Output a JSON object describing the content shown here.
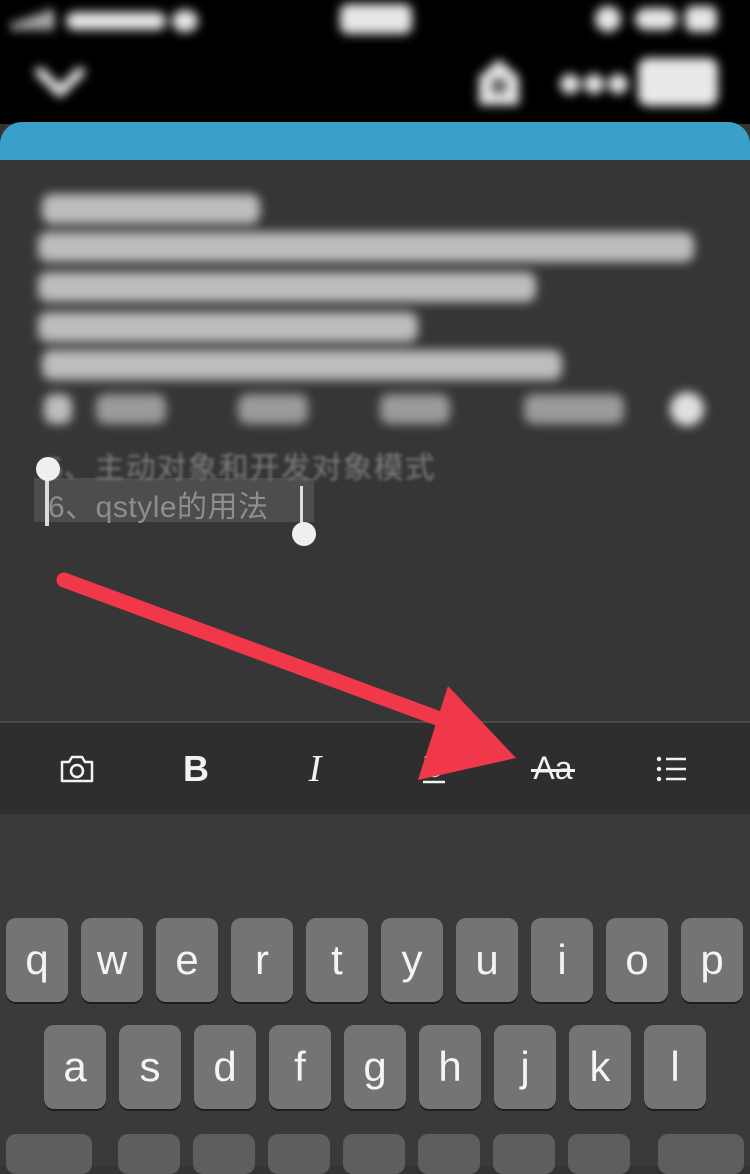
{
  "status_bar": {
    "signal_icon": "cellular-signal-icon",
    "carrier_text": "",
    "time": "",
    "battery_icon": "battery-icon"
  },
  "nav": {
    "back_icon": "chevron-down-icon",
    "home_icon": "home-icon",
    "more_icon": "more-dots-icon",
    "done_label": ""
  },
  "note": {
    "visible_line_5": "5、主动对象和开发对象模式",
    "selected_line_6": "6、qstyle的用法"
  },
  "toolbar": {
    "items": [
      {
        "name": "camera",
        "icon": "camera-icon",
        "label": ""
      },
      {
        "name": "bold",
        "icon": "bold-icon",
        "label": "B"
      },
      {
        "name": "italic",
        "icon": "italic-icon",
        "label": "I"
      },
      {
        "name": "underline",
        "icon": "underline-icon",
        "label": ""
      },
      {
        "name": "strikethrough",
        "icon": "strikethrough-icon",
        "label": "Aa"
      },
      {
        "name": "list",
        "icon": "list-icon",
        "label": ""
      }
    ]
  },
  "annotation": {
    "icon": "red-arrow-icon",
    "color": "#f0384a",
    "target": "strikethrough"
  },
  "keyboard": {
    "row1": [
      "q",
      "w",
      "e",
      "r",
      "t",
      "y",
      "u",
      "i",
      "o",
      "p"
    ],
    "row2": [
      "a",
      "s",
      "d",
      "f",
      "g",
      "h",
      "j",
      "k",
      "l"
    ]
  },
  "colors": {
    "accent_bar": "#3aa0c9",
    "background": "#343434",
    "arrow": "#f0384a"
  }
}
